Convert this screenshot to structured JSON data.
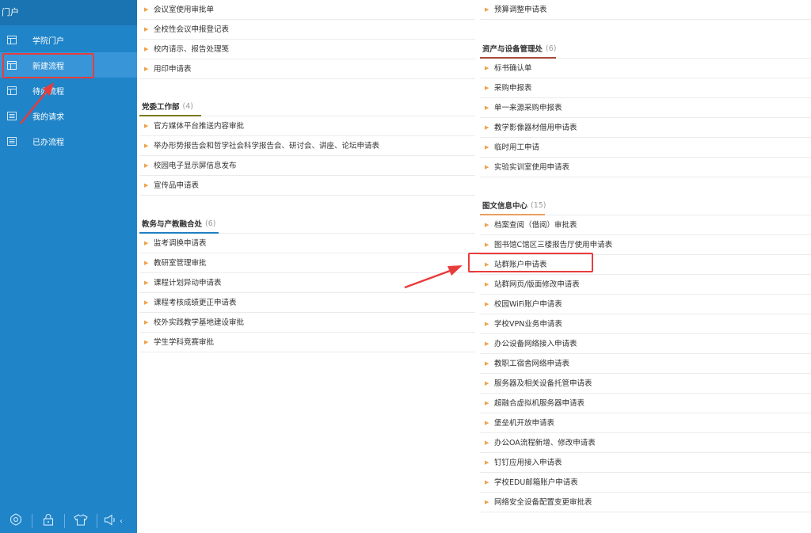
{
  "sidebar": {
    "portal_label": "门户",
    "items": [
      {
        "label": "学院门户",
        "icon": "portal-icon",
        "active": false
      },
      {
        "label": "新建流程",
        "icon": "new-flow-icon",
        "active": true
      },
      {
        "label": "待办流程",
        "icon": "todo-icon",
        "active": false
      },
      {
        "label": "我的请求",
        "icon": "request-icon",
        "active": false
      },
      {
        "label": "已办流程",
        "icon": "done-icon",
        "active": false
      }
    ],
    "bottom_icons": [
      "settings-icon",
      "lock-icon",
      "theme-shirt-icon",
      "sound-icon"
    ],
    "collapse_glyph": "‹"
  },
  "colors": {
    "sidebar_bg": "#1f84c8",
    "active_bg": "#3895d7",
    "annotation_red": "#e83c3c",
    "underline_olive": "#7a7a1e",
    "underline_blue": "#1f7fc3",
    "underline_red": "#a84a3a",
    "underline_orange": "#e8a060",
    "arrow_marker": "#f0a24a"
  },
  "left_column": {
    "top_items": [
      "会议室使用审批单",
      "全校性会议申报登记表",
      "校内请示、报告处理笺",
      "用印申请表"
    ],
    "sections": [
      {
        "name": "党委工作部",
        "count": "(4)",
        "items": [
          "官方媒体平台推送内容审批",
          "举办形势报告会和哲学社会科学报告会、研讨会、讲座、论坛申请表",
          "校园电子显示屏信息发布",
          "宣传品申请表"
        ]
      },
      {
        "name": "教务与产教融合处",
        "count": "(6)",
        "items": [
          "监考调换申请表",
          "教研室管理审批",
          "课程计划异动申请表",
          "课程考核成绩更正申请表",
          "校外实践教学基地建设审批",
          "学生学科竞赛审批"
        ]
      }
    ]
  },
  "right_column": {
    "top_items": [
      "预算调整申请表"
    ],
    "sections": [
      {
        "name": "资产与设备管理处",
        "count": "(6)",
        "items": [
          "标书确认单",
          "采购申报表",
          "单一来源采购申报表",
          "教学影像器材借用申请表",
          "临时用工申请",
          "实验实训室使用申请表"
        ]
      },
      {
        "name": "图文信息中心",
        "count": "(15)",
        "items": [
          "档案查阅（借阅）审批表",
          "图书馆C馆区三楼报告厅使用申请表",
          "站群账户申请表",
          "站群网页/版面修改申请表",
          "校园WiFi账户申请表",
          "学校VPN业务申请表",
          "办公设备网络接入申请表",
          "教职工宿舍网络申请表",
          "服务器及相关设备托管申请表",
          "超融合虚拟机服务器申请表",
          "堡垒机开放申请表",
          "办公OA流程新增、修改申请表",
          "钉钉应用接入申请表",
          "学校EDU邮箱账户申请表",
          "网络安全设备配置变更审批表"
        ]
      }
    ]
  }
}
